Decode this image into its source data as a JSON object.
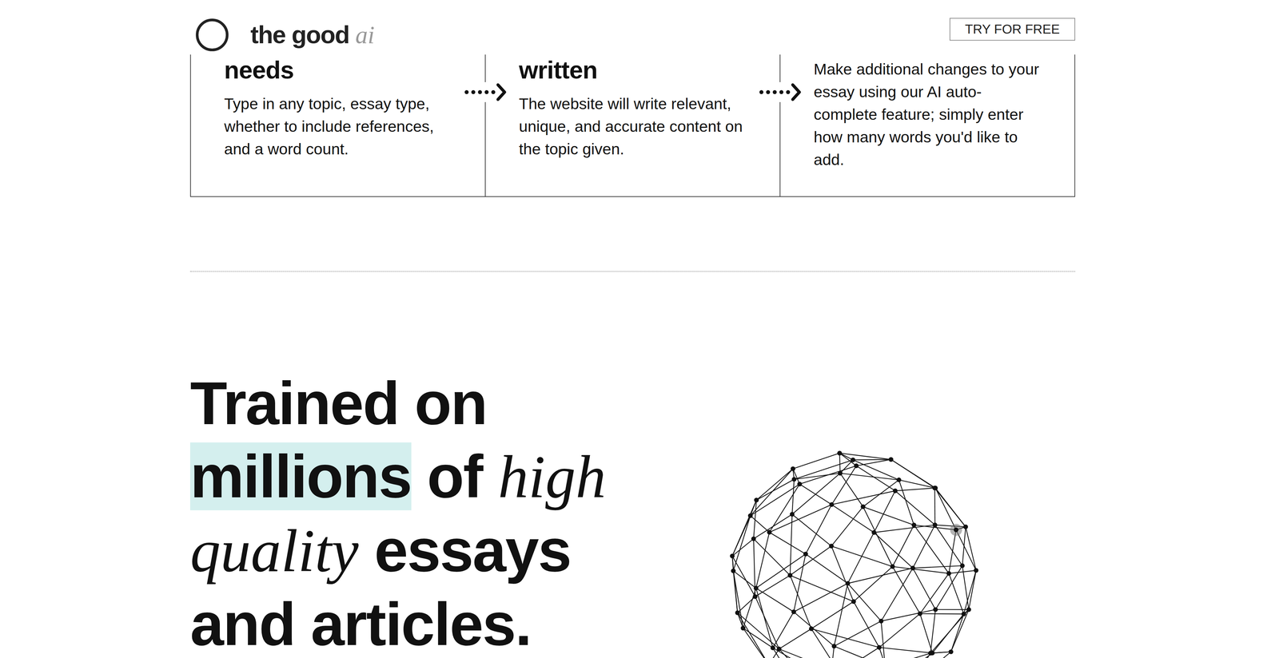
{
  "header": {
    "logo": {
      "text": "the good",
      "accent": "ai"
    },
    "cta": "TRY FOR FREE"
  },
  "steps": [
    {
      "title": "needs",
      "body": "Type in any topic, essay type, whether to include references, and a word count."
    },
    {
      "title": "written",
      "body": "The website will write relevant, unique, and accurate content on the topic given."
    },
    {
      "title": "",
      "body": "Make additional changes to your essay using our AI auto-complete feature; simply enter how many words you'd like to add."
    }
  ],
  "headline": [
    [
      {
        "text": "Trained on",
        "style": "plain"
      }
    ],
    [
      {
        "text": "millions",
        "style": "highlight"
      },
      {
        "text": " of ",
        "style": "plain"
      },
      {
        "text": "high",
        "style": "italic"
      }
    ],
    [
      {
        "text": "quality",
        "style": "italic"
      },
      {
        "text": " essays",
        "style": "plain"
      }
    ],
    [
      {
        "text": "and articles.",
        "style": "plain"
      }
    ]
  ]
}
